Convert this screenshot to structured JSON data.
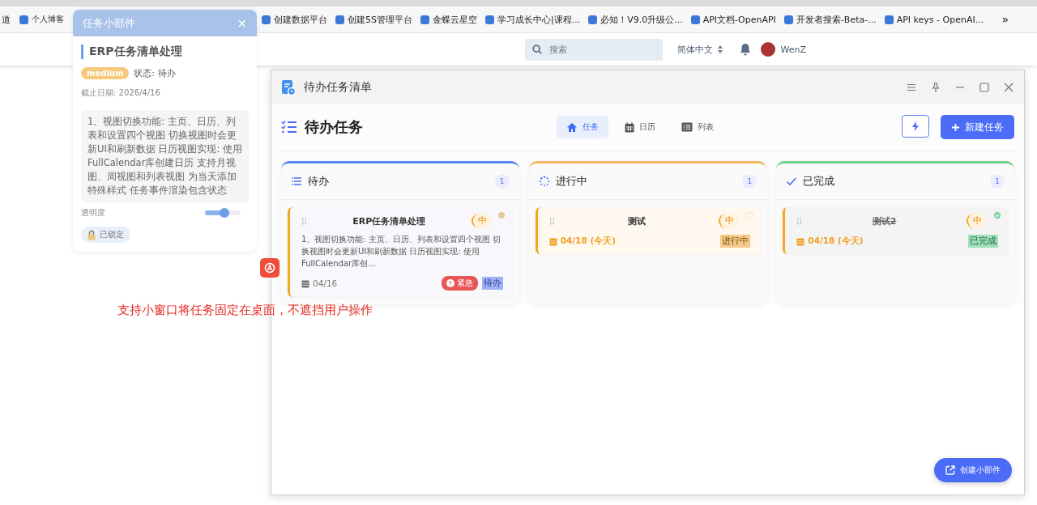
{
  "browser": {
    "bookmarks": [
      {
        "label": "道"
      },
      {
        "label": "个人博客"
      },
      {
        "label": "创建数据平台"
      },
      {
        "label": "创建5S管理平台"
      },
      {
        "label": "金蝶云星空"
      },
      {
        "label": "学习成长中心|课程..."
      },
      {
        "label": "必知！V9.0升级公..."
      },
      {
        "label": "API文档-OpenAPI"
      },
      {
        "label": "开发者搜索-Beta-..."
      },
      {
        "label": "API keys - OpenAI..."
      }
    ],
    "overflow": "»"
  },
  "site_header": {
    "search": {
      "placeholder": "搜索"
    },
    "language": "简体中文",
    "user": "WenZ"
  },
  "widget": {
    "title": "任务小部件",
    "close": "×",
    "task_title": "ERP任务清单处理",
    "priority": "medium",
    "status": "状态: 待办",
    "due": "截止日期: 2026/4/16",
    "description": "1、视图切换功能: 主页、日历、列表和设置四个视图 切换视图时会更新UI和刷新数据 日历视图实现: 使用FullCalendar库创建日历 支持月视图、周视图和列表视图 为当天添加特殊样式 任务事件渲染包含状态",
    "opacity_label": "透明度",
    "opacity": {
      "level": 0.55
    },
    "lock": {
      "label": "已锁定",
      "locked": true
    }
  },
  "annotation": "支持小窗口将任务固定在桌面，不遮挡用户操作",
  "app": {
    "title": "待办任务清单",
    "heading": "待办任务",
    "tabs": [
      {
        "label": "任务",
        "selected": true
      },
      {
        "label": "日历",
        "selected": false
      },
      {
        "label": "列表",
        "selected": false
      }
    ],
    "new_button": "新建任务",
    "create_widget": "创建小部件",
    "columns": [
      {
        "title": "待办",
        "kind": "todo",
        "color": "#5b86f5",
        "count": "1",
        "cards": [
          {
            "title": "ERP任务清单处理",
            "priority": "中",
            "description": "1、视图切换功能: 主页、日历、列表和设置四个视图 切换视图时会更新UI和刷新数据 日历视图实现: 使用FullCalendar库创...",
            "date": "04/16",
            "due_today": false,
            "urgent": "紧急",
            "status": "待办"
          }
        ]
      },
      {
        "title": "进行中",
        "kind": "doing",
        "color": "#f5b461",
        "count": "1",
        "cards": [
          {
            "title": "测试",
            "priority": "中",
            "date": "04/18 (今天)",
            "due_today": true,
            "status": "进行中"
          }
        ]
      },
      {
        "title": "已完成",
        "kind": "done",
        "color": "#6fd08f",
        "count": "1",
        "cards": [
          {
            "title": "测试2",
            "priority": "中",
            "date": "04/18 (今天)",
            "due_today": true,
            "status": "已完成"
          }
        ]
      }
    ]
  }
}
